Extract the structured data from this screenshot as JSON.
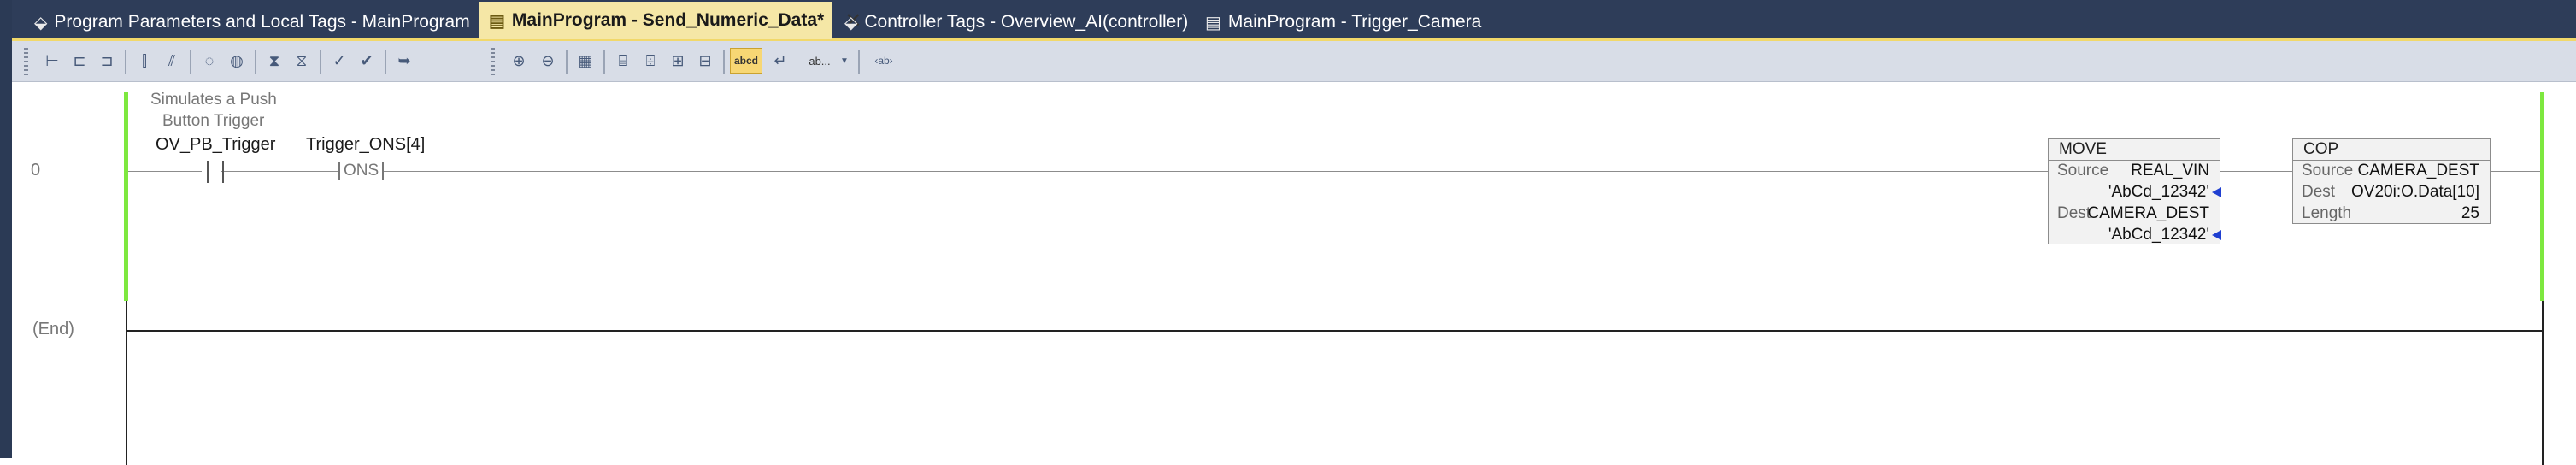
{
  "tabs": [
    {
      "label": "Program Parameters and Local Tags - MainProgram",
      "icon": "tag-icon",
      "active": false
    },
    {
      "label": "MainProgram - Send_Numeric_Data*",
      "icon": "ladder-routine-icon",
      "active": true,
      "close": "✕"
    },
    {
      "label": "Controller Tags - Overview_AI(controller)",
      "icon": "tag-icon",
      "active": false
    },
    {
      "label": "MainProgram - Trigger_Camera",
      "icon": "ladder-routine-icon",
      "active": false
    }
  ],
  "toolbar": {
    "tag_names_toggle": "abcd",
    "description_toggle": "ab..."
  },
  "rungs": [
    {
      "number": "0",
      "comment_line1": "Simulates a Push",
      "comment_line2": "Button Trigger",
      "xic_tag": "OV_PB_Trigger",
      "ons_tag": "Trigger_ONS[4]",
      "ons_label": "ONS",
      "move": {
        "title": "MOVE",
        "source_label": "Source",
        "source_tag": "REAL_VIN",
        "source_value": "'AbCd_12342'",
        "dest_label": "Dest",
        "dest_tag": "CAMERA_DEST",
        "dest_value": "'AbCd_12342'"
      },
      "cop": {
        "title": "COP",
        "source_label": "Source",
        "source_tag": "CAMERA_DEST",
        "dest_label": "Dest",
        "dest_tag": "OV20i:O.Data[10]",
        "length_label": "Length",
        "length_value": "25"
      }
    }
  ],
  "end_label": "(End)",
  "colors": {
    "tab_bar": "#2e3d59",
    "active_tab": "#f5e7a6",
    "power_rail": "#7ee83f",
    "toolbar": "#d8dde7"
  }
}
